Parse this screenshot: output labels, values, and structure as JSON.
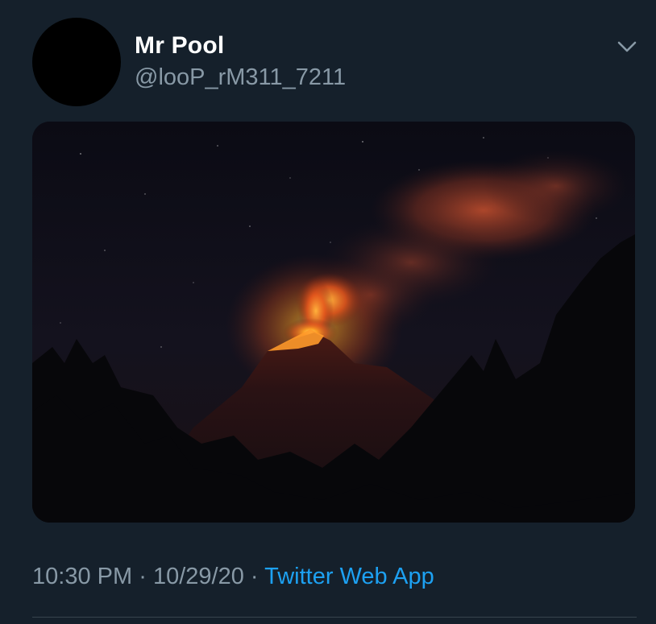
{
  "tweet": {
    "author": {
      "display_name": "Mr Pool",
      "handle": "@looP_rM311_7211"
    },
    "media": {
      "alt": "Erupting volcano at night"
    },
    "meta": {
      "time": "10:30 PM",
      "separator": "·",
      "date": "10/29/20",
      "source": "Twitter Web App"
    }
  },
  "icons": {
    "menu": "chevron-down-icon"
  },
  "colors": {
    "background": "#15202b",
    "primary_text": "#ffffff",
    "secondary_text": "#8899a6",
    "link": "#1da1f2"
  }
}
